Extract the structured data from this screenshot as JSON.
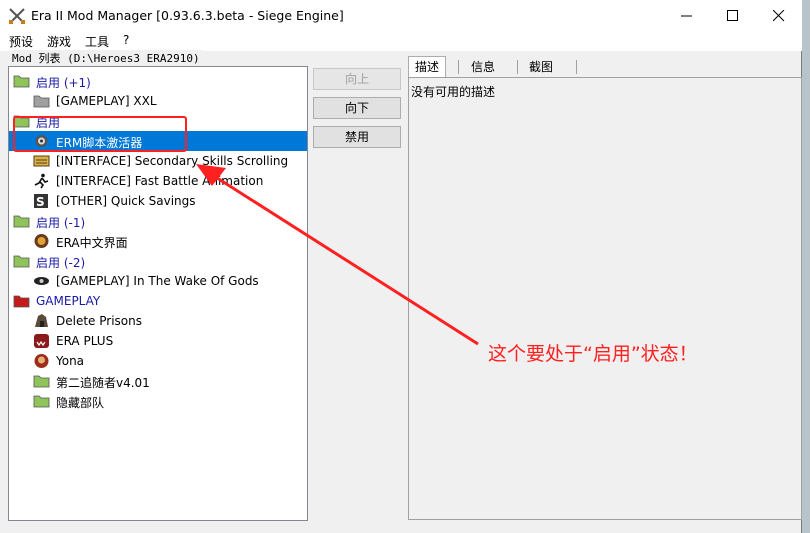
{
  "window": {
    "title": "Era II Mod Manager [0.93.6.3.beta - Siege Engine]"
  },
  "menu": [
    "预设",
    "游戏",
    "工具",
    "?"
  ],
  "mod_list_label": "Mod 列表 (D:\\Heroes3 ERA2910)",
  "tree": [
    {
      "label": "启用 (+1)",
      "kind": "group",
      "icon": "folder-icon",
      "icon_color": "#8fc45a"
    },
    {
      "label": "[GAMEPLAY] XXL",
      "kind": "mod",
      "icon": "folder-icon",
      "icon_color": "#a0a0a0"
    },
    {
      "label": "启用",
      "kind": "group",
      "icon": "folder-icon",
      "icon_color": "#8fc45a"
    },
    {
      "label": "ERM脚本激活器",
      "kind": "mod",
      "icon": "gear-icon",
      "selected": true
    },
    {
      "label": "[INTERFACE] Secondary Skills Scrolling",
      "kind": "mod",
      "icon": "scroll-icon"
    },
    {
      "label": "[INTERFACE] Fast Battle Animation",
      "kind": "mod",
      "icon": "running-man-icon"
    },
    {
      "label": "[OTHER] Quick Savings",
      "kind": "mod",
      "icon": "save-icon"
    },
    {
      "label": "启用 (-1)",
      "kind": "group",
      "icon": "folder-icon",
      "icon_color": "#8fc45a"
    },
    {
      "label": "ERA中文界面",
      "kind": "mod",
      "icon": "medallion-icon"
    },
    {
      "label": "启用 (-2)",
      "kind": "group",
      "icon": "folder-icon",
      "icon_color": "#8fc45a"
    },
    {
      "label": "[GAMEPLAY] In The Wake Of Gods",
      "kind": "mod",
      "icon": "eye-icon"
    },
    {
      "label": "GAMEPLAY",
      "kind": "group",
      "icon": "folder-icon",
      "icon_color": "#c41a1a"
    },
    {
      "label": "Delete Prisons",
      "kind": "mod",
      "icon": "prison-icon"
    },
    {
      "label": "ERA PLUS",
      "kind": "mod",
      "icon": "creature-icon"
    },
    {
      "label": "Yona",
      "kind": "mod",
      "icon": "portrait-icon"
    },
    {
      "label": "第二追随者v4.01",
      "kind": "mod",
      "icon": "folder-icon",
      "icon_color": "#8fc45a"
    },
    {
      "label": "隐藏部队",
      "kind": "mod",
      "icon": "folder-icon",
      "icon_color": "#8fc45a"
    }
  ],
  "buttons": {
    "up": "向上",
    "down": "向下",
    "disable": "禁用"
  },
  "tabs": [
    "描述",
    "信息",
    "截图"
  ],
  "description": "没有可用的描述",
  "annotation": "这个要处于“启用”状态！",
  "colors": {
    "selection": "#0078d7",
    "group_text": "#1a1aa6",
    "annotation": "#ff2020"
  }
}
